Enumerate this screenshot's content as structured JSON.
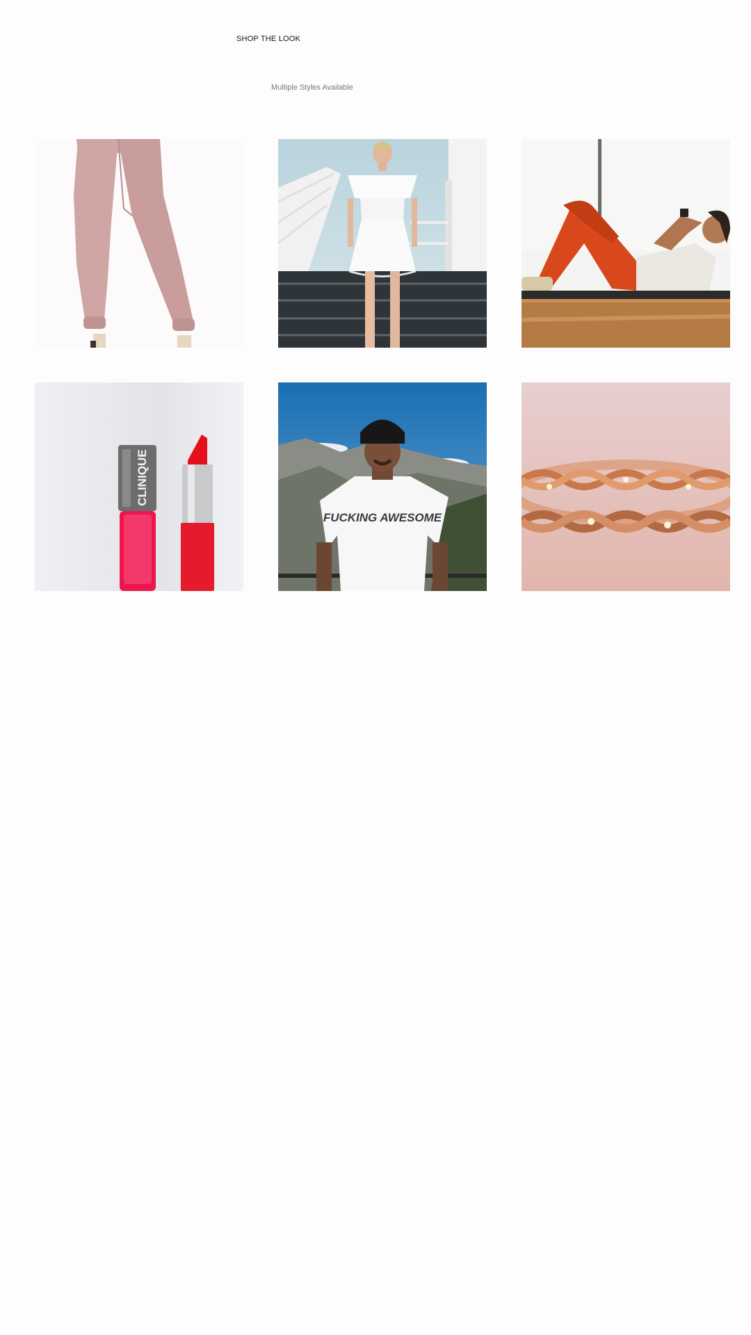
{
  "header": {
    "title": "SHOP THE LOOK",
    "subtitle": "Multiple Styles Available"
  },
  "products": [
    {
      "label": "Pink satin joggers",
      "icon": "pants-icon"
    },
    {
      "label": "White off-shoulder ruffle dress",
      "icon": "dress-icon"
    },
    {
      "label": "Orange workout leggings",
      "icon": "leggings-icon"
    },
    {
      "label": "Lip lacquer and lipstick",
      "icon": "lipstick-icon",
      "brand": "CLINIQUE"
    },
    {
      "label": "Graphic white t-shirt",
      "icon": "tshirt-icon",
      "print": "FUCKING AWESOME"
    },
    {
      "label": "Rose gold bracelet",
      "icon": "bracelet-icon"
    }
  ]
}
